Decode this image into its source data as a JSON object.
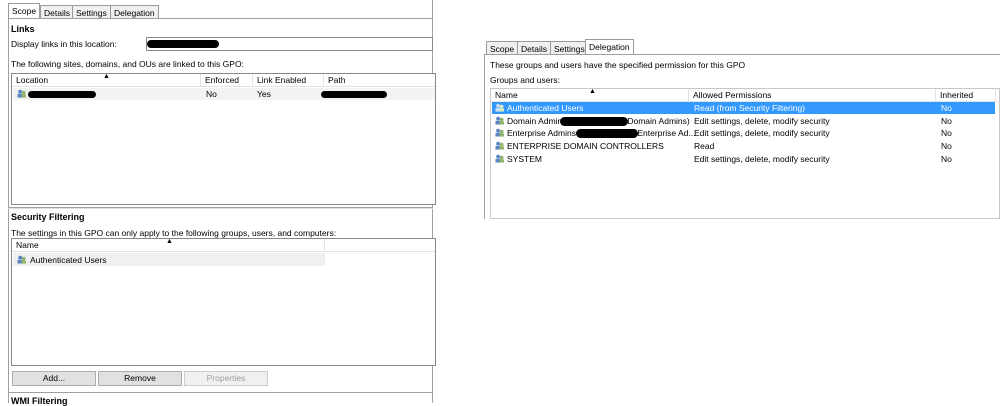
{
  "left": {
    "tabs": [
      "Scope",
      "Details",
      "Settings",
      "Delegation"
    ],
    "links": {
      "title": "Links",
      "display_label": "Display links in this location:",
      "description": "The following sites, domains, and OUs are linked to this GPO:",
      "columns": [
        "Location",
        "Enforced",
        "Link Enabled",
        "Path"
      ],
      "rows": [
        {
          "location": "",
          "enforced": "No",
          "link_enabled": "Yes",
          "path": ""
        }
      ]
    },
    "security_filtering": {
      "title": "Security Filtering",
      "description": "The settings in this GPO can only apply to the following groups, users, and computers:",
      "columns": [
        "Name"
      ],
      "rows": [
        "Authenticated Users"
      ],
      "buttons": {
        "add": "Add...",
        "remove": "Remove",
        "properties": "Properties"
      }
    },
    "wmi_title": "WMI Filtering"
  },
  "right": {
    "tabs": [
      "Scope",
      "Details",
      "Settings",
      "Delegation"
    ],
    "description": "These groups and users have the specified permission for this GPO",
    "groups_label": "Groups and users:",
    "columns": [
      "Name",
      "Allowed Permissions",
      "Inherited"
    ],
    "rows": [
      {
        "name": "Authenticated Users",
        "permissions": "Read (from Security Filtering)",
        "inherited": "No",
        "selected": true
      },
      {
        "name": "Domain Admins",
        "name_suffix": "\\Domain Admins)",
        "permissions": "Edit settings, delete, modify security",
        "inherited": "No"
      },
      {
        "name": "Enterprise Admins",
        "name_suffix": "\\Enterprise Ad...",
        "permissions": "Edit settings, delete, modify security",
        "inherited": "No"
      },
      {
        "name": "ENTERPRISE DOMAIN CONTROLLERS",
        "permissions": "Read",
        "inherited": "No"
      },
      {
        "name": "SYSTEM",
        "permissions": "Edit settings, delete, modify security",
        "inherited": "No"
      }
    ]
  },
  "colors": {
    "selection": "#3399ff",
    "border": "#a0a0a0"
  },
  "icons": [
    "users-icon",
    "domain-icon",
    "sort-up-icon"
  ]
}
